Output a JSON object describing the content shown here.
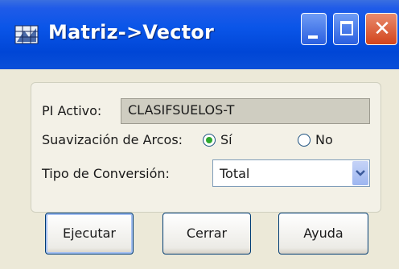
{
  "window": {
    "title": "Matriz->Vector",
    "close_glyph": "✕"
  },
  "form": {
    "pi_label": "PI Activo:",
    "pi_value": "CLASIFSUELOS-T",
    "smoothing_label": "Suavización de Arcos:",
    "smoothing_options": [
      {
        "label": "Sí",
        "selected": true
      },
      {
        "label": "No",
        "selected": false
      }
    ],
    "conversion_label": "Tipo de Conversión:",
    "conversion_value": "Total"
  },
  "buttons": {
    "execute": "Ejecutar",
    "close": "Cerrar",
    "help": "Ayuda"
  },
  "colors": {
    "titlebar": "#0a55e8",
    "close_button": "#d2441c",
    "radio_selected": "#2fa82f"
  }
}
